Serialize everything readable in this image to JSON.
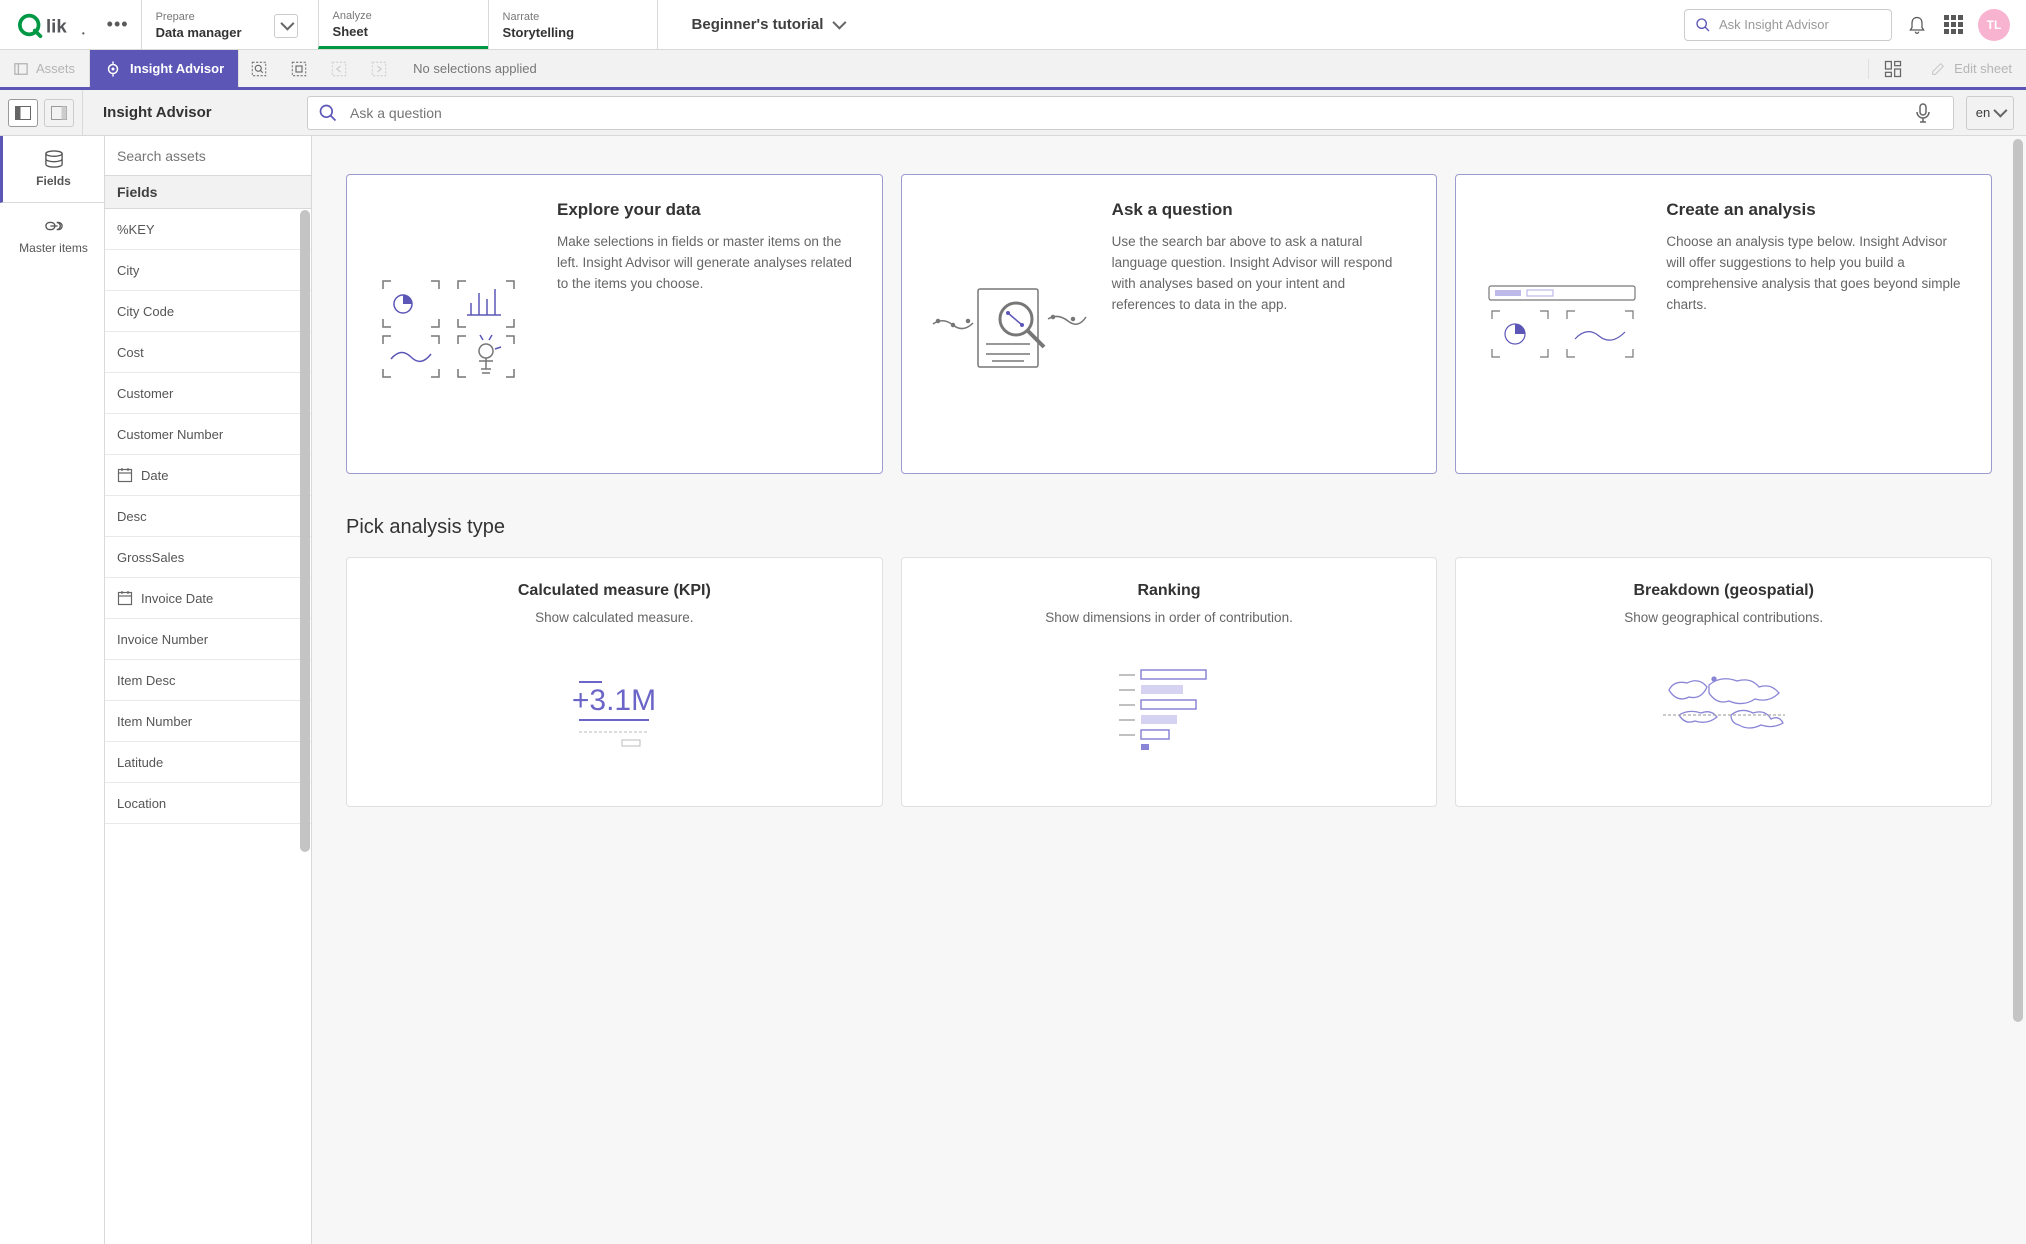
{
  "header": {
    "tabs": {
      "prepare": {
        "small": "Prepare",
        "big": "Data manager"
      },
      "analyze": {
        "small": "Analyze",
        "big": "Sheet"
      },
      "narrate": {
        "small": "Narrate",
        "big": "Storytelling"
      }
    },
    "app_title": "Beginner's tutorial",
    "ask_placeholder": "Ask Insight Advisor",
    "avatar": "TL"
  },
  "toolbar": {
    "assets": "Assets",
    "insight_advisor": "Insight Advisor",
    "no_selections": "No selections applied",
    "edit_sheet": "Edit sheet"
  },
  "subheader": {
    "title": "Insight Advisor",
    "question_placeholder": "Ask a question",
    "lang": "en"
  },
  "rail": {
    "fields": "Fields",
    "master_items": "Master items"
  },
  "assets": {
    "search_placeholder": "Search assets",
    "group": "Fields",
    "items": [
      {
        "label": "%KEY",
        "icon": ""
      },
      {
        "label": "City",
        "icon": ""
      },
      {
        "label": "City Code",
        "icon": ""
      },
      {
        "label": "Cost",
        "icon": ""
      },
      {
        "label": "Customer",
        "icon": ""
      },
      {
        "label": "Customer Number",
        "icon": ""
      },
      {
        "label": "Date",
        "icon": "date"
      },
      {
        "label": "Desc",
        "icon": ""
      },
      {
        "label": "GrossSales",
        "icon": ""
      },
      {
        "label": "Invoice Date",
        "icon": "date"
      },
      {
        "label": "Invoice Number",
        "icon": ""
      },
      {
        "label": "Item Desc",
        "icon": ""
      },
      {
        "label": "Item Number",
        "icon": ""
      },
      {
        "label": "Latitude",
        "icon": ""
      },
      {
        "label": "Location",
        "icon": ""
      }
    ]
  },
  "intro": [
    {
      "title": "Explore your data",
      "desc": "Make selections in fields or master items on the left. Insight Advisor will generate analyses related to the items you choose."
    },
    {
      "title": "Ask a question",
      "desc": "Use the search bar above to ask a natural language question. Insight Advisor will respond with analyses based on your intent and references to data in the app."
    },
    {
      "title": "Create an analysis",
      "desc": "Choose an analysis type below. Insight Advisor will offer suggestions to help you build a comprehensive analysis that goes beyond simple charts."
    }
  ],
  "section_title": "Pick analysis type",
  "analysis": [
    {
      "title": "Calculated measure (KPI)",
      "desc": "Show calculated measure."
    },
    {
      "title": "Ranking",
      "desc": "Show dimensions in order of contribution."
    },
    {
      "title": "Breakdown (geospatial)",
      "desc": "Show geographical contributions."
    }
  ]
}
